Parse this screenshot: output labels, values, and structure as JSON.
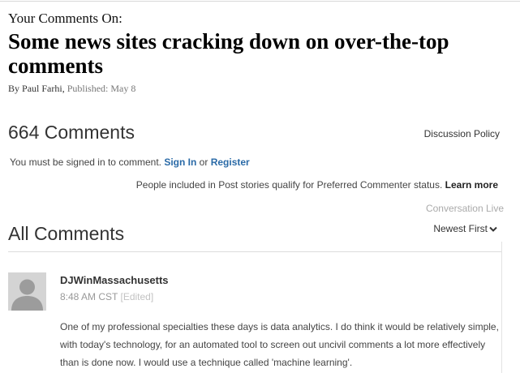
{
  "article": {
    "kicker": "Your Comments On:",
    "headline": "Some news sites cracking down on over-the-top comments",
    "byline_prefix": "By ",
    "author": "Paul Farhi",
    "byline_sep": ", ",
    "published": "Published: May 8"
  },
  "comments_header": {
    "count_label": "664 Comments",
    "policy_link": "Discussion Policy",
    "signin_prefix": "You must be signed in to comment. ",
    "signin_link": "Sign In",
    "or_text": " or ",
    "register_link": "Register",
    "preferred_text": "People included in Post stories qualify for Preferred Commenter status. ",
    "learn_more_link": "Learn more",
    "conversation_live": "Conversation Live"
  },
  "list": {
    "title": "All Comments",
    "sort_label": "Newest First",
    "sort_icon": "chevron-down-icon"
  },
  "comments": [
    {
      "author": "DJWinMassachusetts",
      "time": "8:48 AM CST",
      "edited": "[Edited]",
      "avatar_icon": "default-avatar",
      "text": "One of my professional specialties these days is data analytics. I do think it would be relatively simple, with today's technology, for an automated tool to screen out uncivil comments a lot more effectively than is done now. I would use a technique called 'machine learning'."
    }
  ],
  "colors": {
    "link_blue": "#2a6aa7",
    "muted_gray": "#999999",
    "avatar_gray": "#d4d4d4"
  }
}
